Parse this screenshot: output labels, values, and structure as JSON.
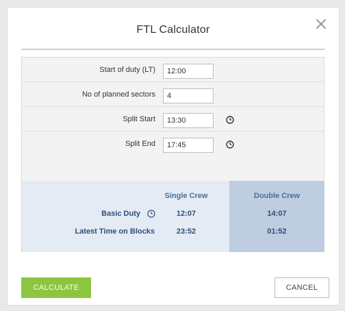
{
  "dialog": {
    "title": "FTL Calculator",
    "close_icon": "close-icon"
  },
  "form": {
    "start_of_duty": {
      "label": "Start of duty (LT)",
      "value": "12:00"
    },
    "planned_sectors": {
      "label": "No of planned sectors",
      "value": "4"
    },
    "split_start": {
      "label": "Split Start",
      "value": "13:30",
      "icon": "clock-icon"
    },
    "split_end": {
      "label": "Split End",
      "value": "17:45",
      "icon": "clock-icon"
    }
  },
  "results": {
    "single_crew_header": "Single Crew",
    "double_crew_header": "Double Crew",
    "rows": [
      {
        "label": "Basic Duty",
        "single": "12:07",
        "double": "14:07",
        "icon": "info-icon"
      },
      {
        "label": "Latest Time on Blocks",
        "single": "23:52",
        "double": "01:52"
      }
    ]
  },
  "buttons": {
    "calculate": "CALCULATE",
    "cancel": "CANCEL"
  },
  "colors": {
    "calculate_bg": "#8cc63f",
    "results_bg": "#e4ebf4",
    "double_crew_bg": "#bfcde0",
    "results_text": "#2e4f7a"
  }
}
